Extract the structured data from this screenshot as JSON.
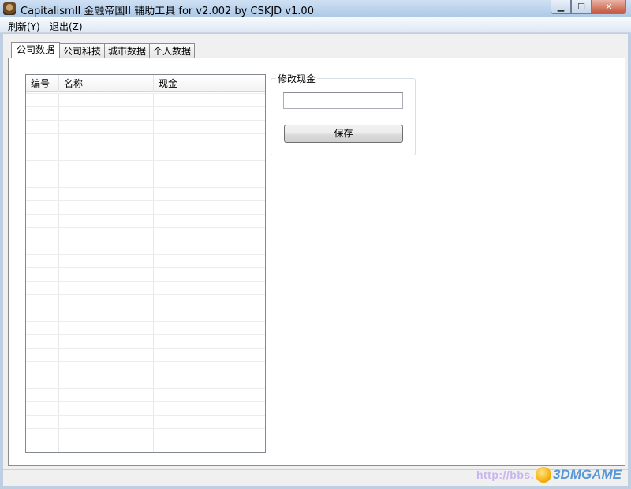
{
  "window": {
    "title": "CapitalismII 金融帝国II 辅助工具 for v2.002 by CSKJD v1.00",
    "controls": {
      "minimize": "▁",
      "maximize": "☐",
      "close": "✕"
    }
  },
  "menu": {
    "items": [
      {
        "label": "刷新(Y)"
      },
      {
        "label": "退出(Z)"
      }
    ]
  },
  "tabs": [
    {
      "label": "公司数据",
      "active": true
    },
    {
      "label": "公司科技",
      "active": false
    },
    {
      "label": "城市数据",
      "active": false
    },
    {
      "label": "个人数据",
      "active": false
    }
  ],
  "company_list": {
    "columns": [
      {
        "label": "编号"
      },
      {
        "label": "名称"
      },
      {
        "label": "现金"
      }
    ],
    "rows": []
  },
  "cash_editor": {
    "group_title": "修改现金",
    "input_value": "",
    "save_label": "保存"
  },
  "watermark": {
    "url_text": "http://bbs.",
    "brand_text": "3DMGAME"
  }
}
